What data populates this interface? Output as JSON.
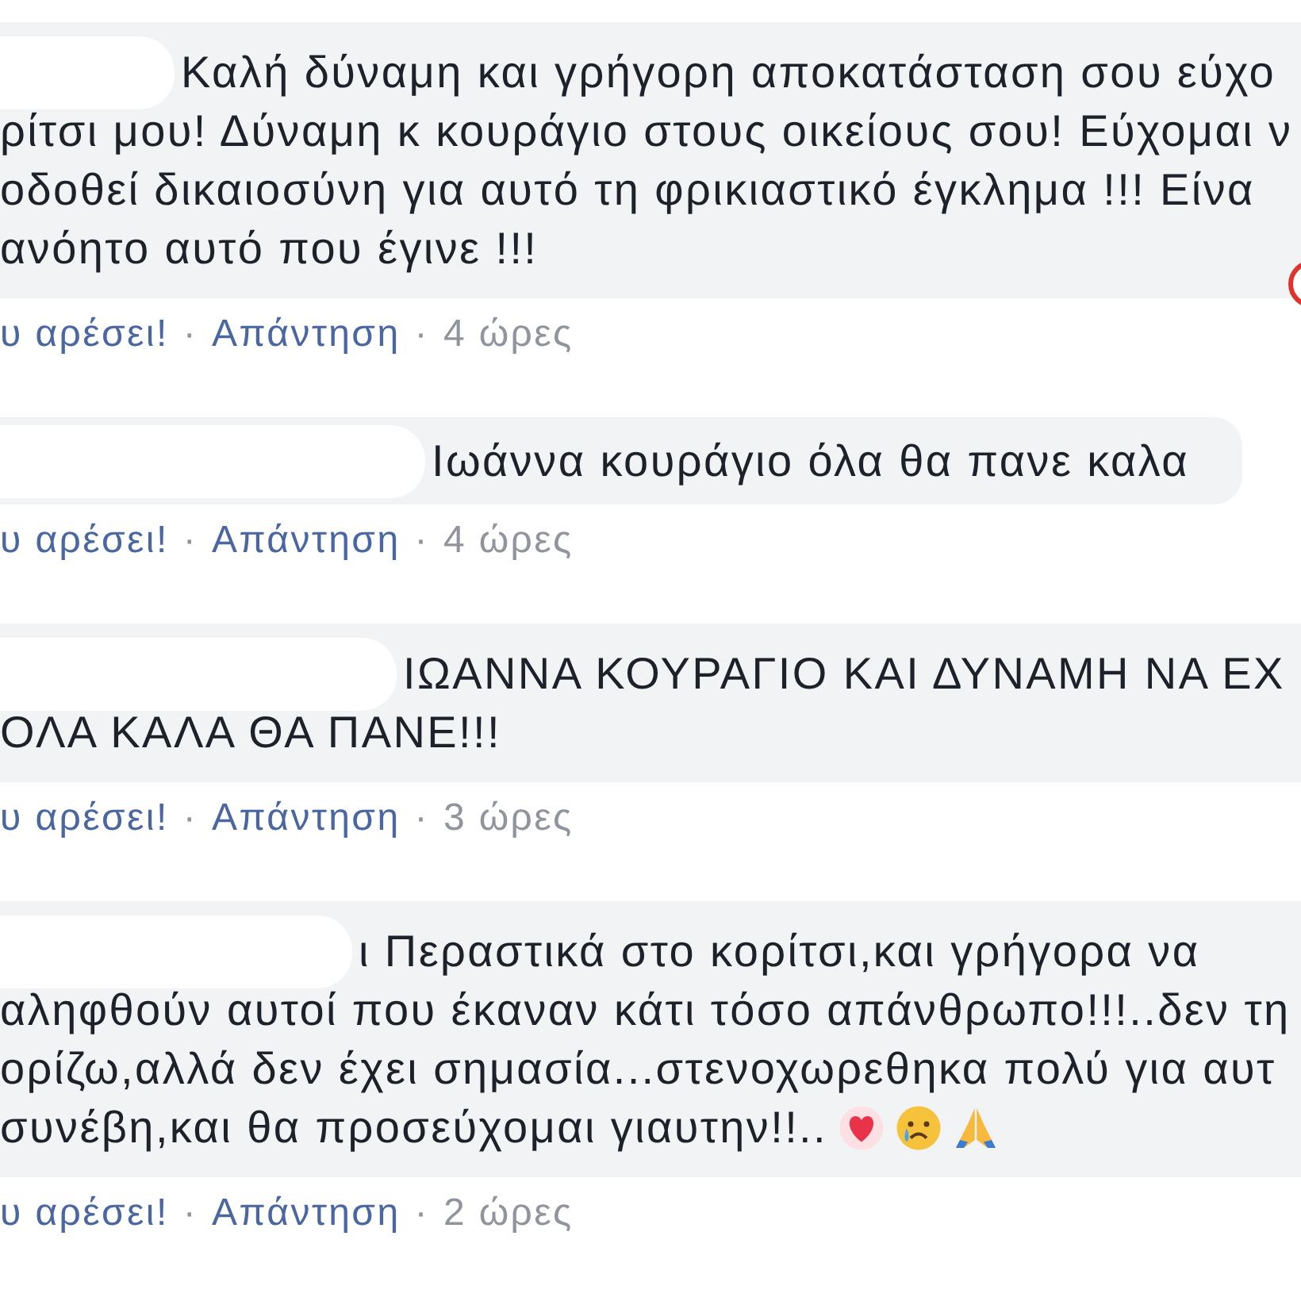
{
  "comments": [
    {
      "name_hidden": true,
      "lines": [
        "Καλή δύναμη και γρήγορη αποκατάσταση σου εύχο",
        "ρίτσι μου! Δύναμη κ κουράγιο στους οικείους σου! Εύχομαι ν",
        "οδοθεί δικαιοσύνη για αυτό τη φρικιαστικό έγκλημα !!! Είνα",
        "ανόητο αυτό που έγινε !!!"
      ],
      "reaction_badge": true,
      "actions": [
        {
          "kind": "link",
          "text": "υ αρέσει!"
        },
        {
          "kind": "separator",
          "text": "·"
        },
        {
          "kind": "link",
          "text": "Απάντηση"
        },
        {
          "kind": "separator",
          "text": "·"
        },
        {
          "kind": "time",
          "text": "4 ώρες"
        }
      ]
    },
    {
      "name_hidden": true,
      "lines": [
        "Ιωάννα κουράγιο όλα θα πανε καλα"
      ],
      "reaction_badge": false,
      "actions": [
        {
          "kind": "link",
          "text": "υ αρέσει!"
        },
        {
          "kind": "separator",
          "text": "·"
        },
        {
          "kind": "link",
          "text": "Απάντηση"
        },
        {
          "kind": "separator",
          "text": "·"
        },
        {
          "kind": "time",
          "text": "4 ώρες"
        }
      ]
    },
    {
      "name_hidden": true,
      "lines": [
        "ΙΩΑΝΝΑ ΚΟΥΡΑΓΙΟ ΚΑΙ ΔΥΝΑΜΗ ΝΑ ΕΧ",
        "ΟΛΑ ΚΑΛΑ ΘΑ ΠΑΝΕ!!!"
      ],
      "reaction_badge": false,
      "actions": [
        {
          "kind": "link",
          "text": "υ αρέσει!"
        },
        {
          "kind": "separator",
          "text": "·"
        },
        {
          "kind": "link",
          "text": "Απάντηση"
        },
        {
          "kind": "separator",
          "text": "·"
        },
        {
          "kind": "time",
          "text": "3 ώρες"
        }
      ]
    },
    {
      "name_hidden": true,
      "lines": [
        "ι Περαστικά στο κορίτσι,και γρήγορα να",
        "αληφθούν αυτοί που έκαναν κάτι τόσο απάνθρωπο!!!..δεν τη",
        "ορίζω,αλλά δεν έχει σημασία...στενοχωρεθηκα πολύ για αυτ",
        "συνέβη,και θα προσεύχομαι γιαυτην!!.."
      ],
      "emojis": [
        {
          "kind": "heart"
        },
        {
          "kind": "crying"
        },
        {
          "kind": "pray"
        }
      ],
      "reaction_badge": false,
      "actions": [
        {
          "kind": "link",
          "text": "υ αρέσει!"
        },
        {
          "kind": "separator",
          "text": "·"
        },
        {
          "kind": "link",
          "text": "Απάντηση"
        },
        {
          "kind": "separator",
          "text": "·"
        },
        {
          "kind": "time",
          "text": "2 ώρες"
        }
      ]
    }
  ]
}
